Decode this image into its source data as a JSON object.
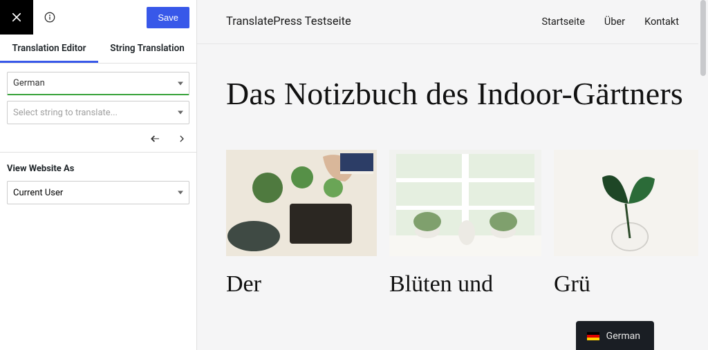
{
  "editor": {
    "save_label": "Save",
    "tabs": {
      "translation_editor": "Translation Editor",
      "string_translation": "String Translation"
    },
    "language_select": {
      "value": "German"
    },
    "string_select": {
      "placeholder": "Select string to translate..."
    },
    "view_as": {
      "label": "View Website As",
      "value": "Current User"
    }
  },
  "site": {
    "title": "TranslatePress Testseite",
    "nav": {
      "home": "Startseite",
      "about": "Über",
      "contact": "Kontakt"
    },
    "heading": "Das Notizbuch des Indoor-Gärtners",
    "cards": [
      {
        "title": "Der"
      },
      {
        "title": "Blüten und"
      },
      {
        "title": "Grü"
      }
    ]
  },
  "language_switcher": {
    "label": "German"
  }
}
